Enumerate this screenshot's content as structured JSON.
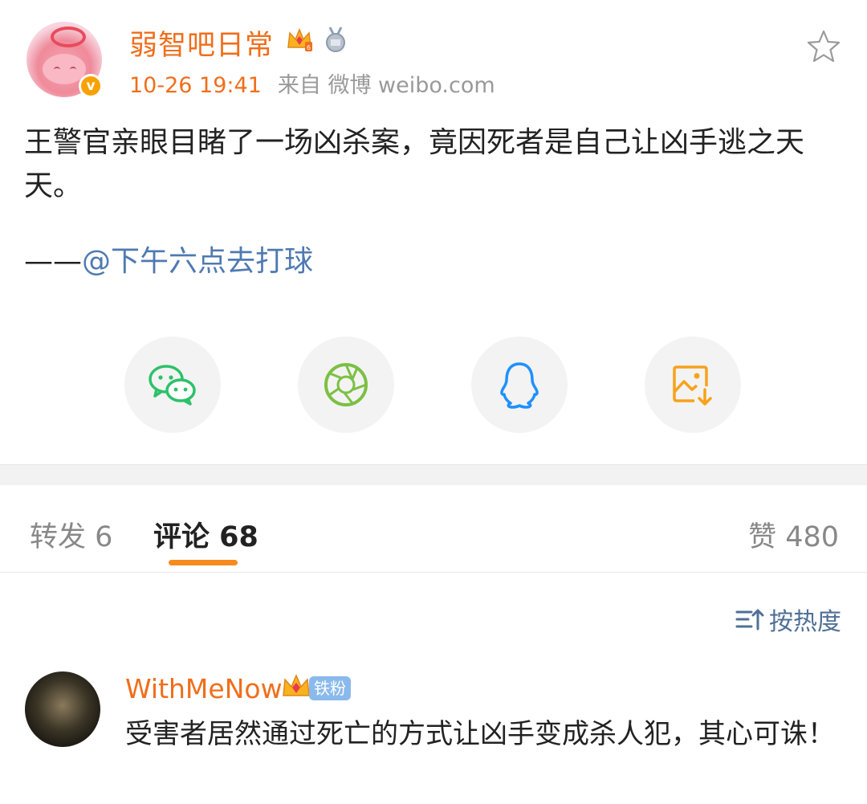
{
  "post": {
    "username": "弱智吧日常",
    "time": "10-26 19:41",
    "source": "来自 微博 weibo.com",
    "content": "王警官亲眼目睹了一场凶杀案，竟因死者是自己让凶手逃之天天。",
    "credit_prefix": "——",
    "credit_mention": "@下午六点去打球",
    "verified_mark": "v"
  },
  "share": {
    "items": [
      "wechat-icon",
      "moments-icon",
      "qq-icon",
      "save-image-icon"
    ],
    "colors": {
      "wechat": "#2dc100",
      "moments": "#7bc043",
      "qq": "#2b90ff",
      "save": "#f7a21b"
    }
  },
  "tabs": {
    "repost": "转发 6",
    "comments": "评论 68",
    "likes": "赞 480"
  },
  "sort": {
    "label": "按热度"
  },
  "comment": {
    "username": "WithMeNow",
    "fan_badge": "铁粉",
    "text": "受害者居然通过死亡的方式让凶手变成杀人犯，其心可诛！"
  },
  "colors": {
    "accent": "#f06e1b",
    "tab_indicator": "#f68a1e",
    "link": "#4f7ab1"
  }
}
